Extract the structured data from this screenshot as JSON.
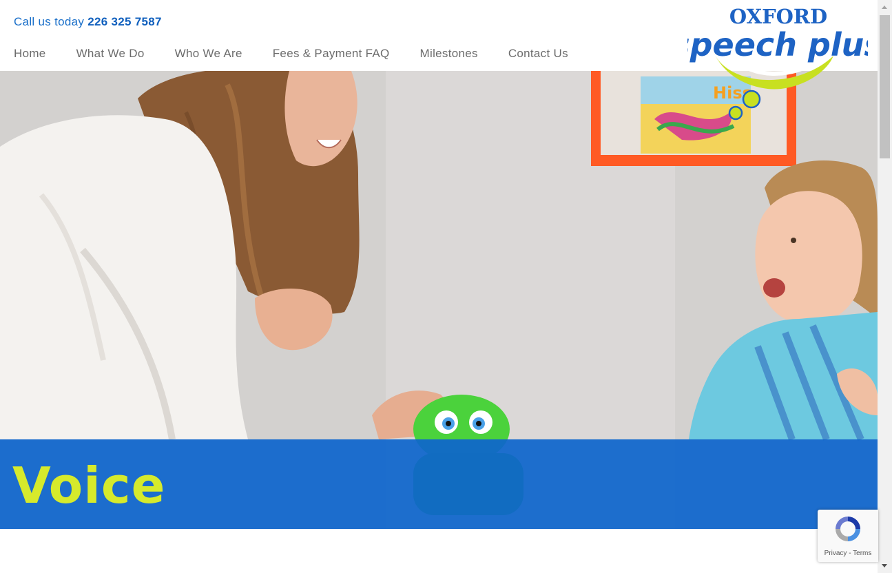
{
  "header": {
    "call_prefix": "Call us today",
    "phone": "226 325 7587"
  },
  "nav": {
    "items": [
      "Home",
      "What We Do",
      "Who We Are",
      "Fees & Payment FAQ",
      "Milestones",
      "Contact Us"
    ]
  },
  "logo": {
    "line1": "OXFORD",
    "line2": "speech plus"
  },
  "hero": {
    "title": "Voice",
    "image_description_icon": "hero-photo"
  },
  "recaptcha": {
    "privacy": "Privacy",
    "separator": " - ",
    "terms": "Terms"
  },
  "colors": {
    "brand_blue": "#0e65cc",
    "accent_lime": "#d6ea2c",
    "nav_gray": "#6b6b6b"
  }
}
